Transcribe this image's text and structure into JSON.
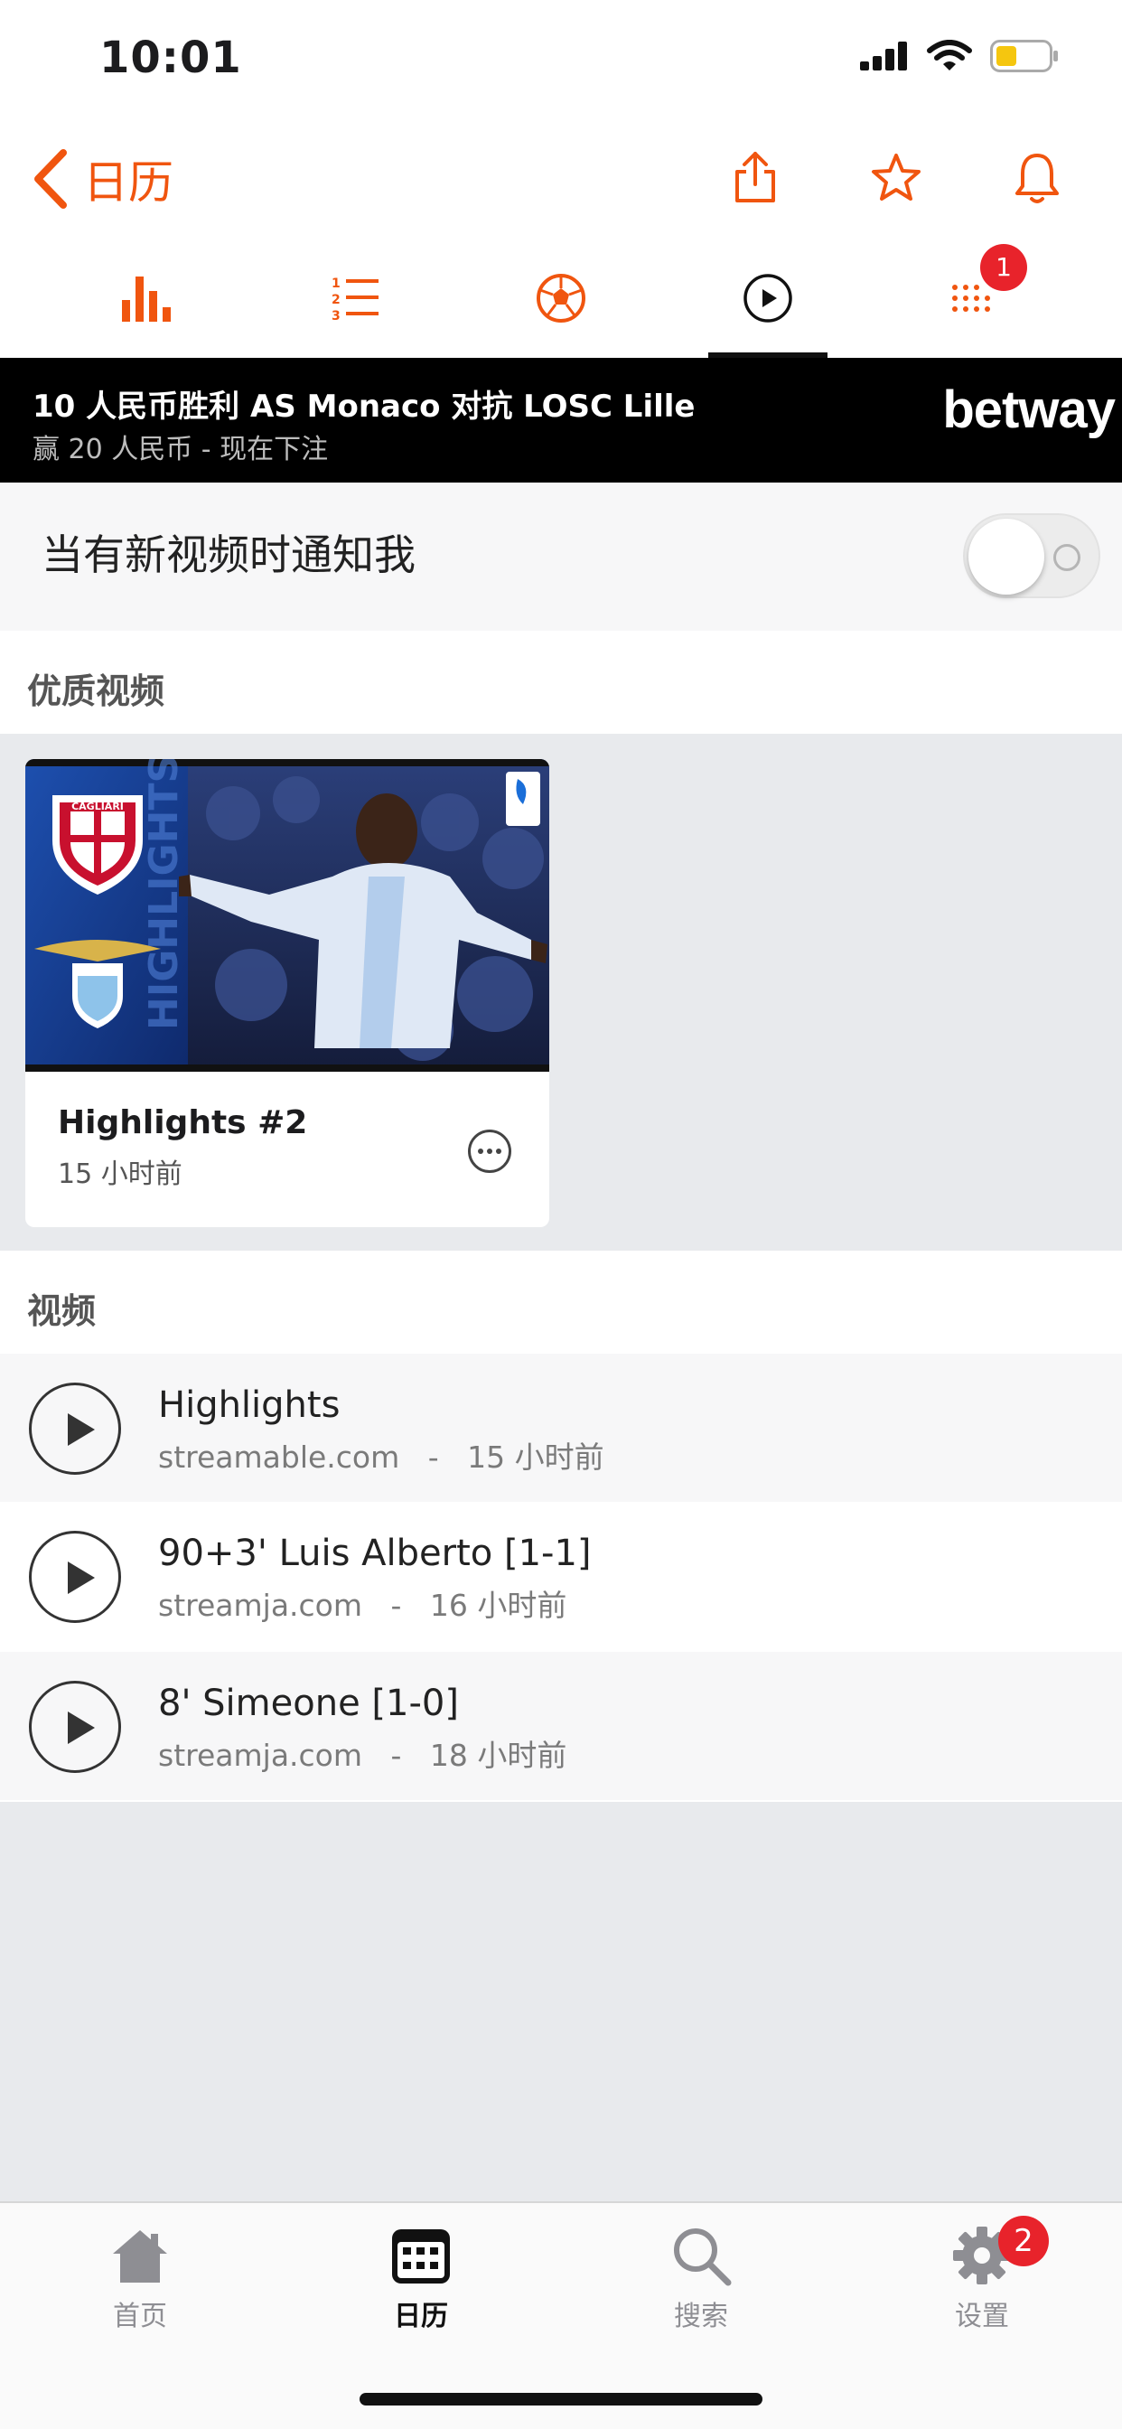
{
  "status_bar": {
    "time": "10:01"
  },
  "nav": {
    "back_label": "日历"
  },
  "tabs": [
    {
      "icon": "bar-chart-icon"
    },
    {
      "icon": "numbered-list-icon"
    },
    {
      "icon": "soccer-ball-icon"
    },
    {
      "icon": "play-circle-icon",
      "active": true
    },
    {
      "icon": "dots-grid-icon",
      "badge": "1"
    }
  ],
  "ad": {
    "title": "10 人民币胜利 AS Monaco 对抗 LOSC Lille",
    "subtitle": "赢 20 人民币 - 现在下注",
    "brand": "betway"
  },
  "notify": {
    "label": "当有新视频时通知我",
    "enabled": false
  },
  "featured": {
    "heading": "优质视频",
    "card": {
      "title": "Highlights #2",
      "time": "15 小时前"
    }
  },
  "videos": {
    "heading": "视频",
    "items": [
      {
        "title": "Highlights",
        "source": "streamable.com",
        "time": "15 小时前"
      },
      {
        "title": "90+3' Luis Alberto [1-1]",
        "source": "streamja.com",
        "time": "16 小时前"
      },
      {
        "title": "8' Simeone [1-0]",
        "source": "streamja.com",
        "time": "18 小时前"
      }
    ]
  },
  "tabbar": {
    "items": [
      {
        "label": "首页",
        "icon": "home-icon"
      },
      {
        "label": "日历",
        "icon": "calendar-icon",
        "active": true
      },
      {
        "label": "搜索",
        "icon": "search-icon"
      },
      {
        "label": "设置",
        "icon": "gear-icon",
        "badge": "2"
      }
    ]
  },
  "colors": {
    "accent": "#f0550f",
    "badge": "#e8232b"
  }
}
